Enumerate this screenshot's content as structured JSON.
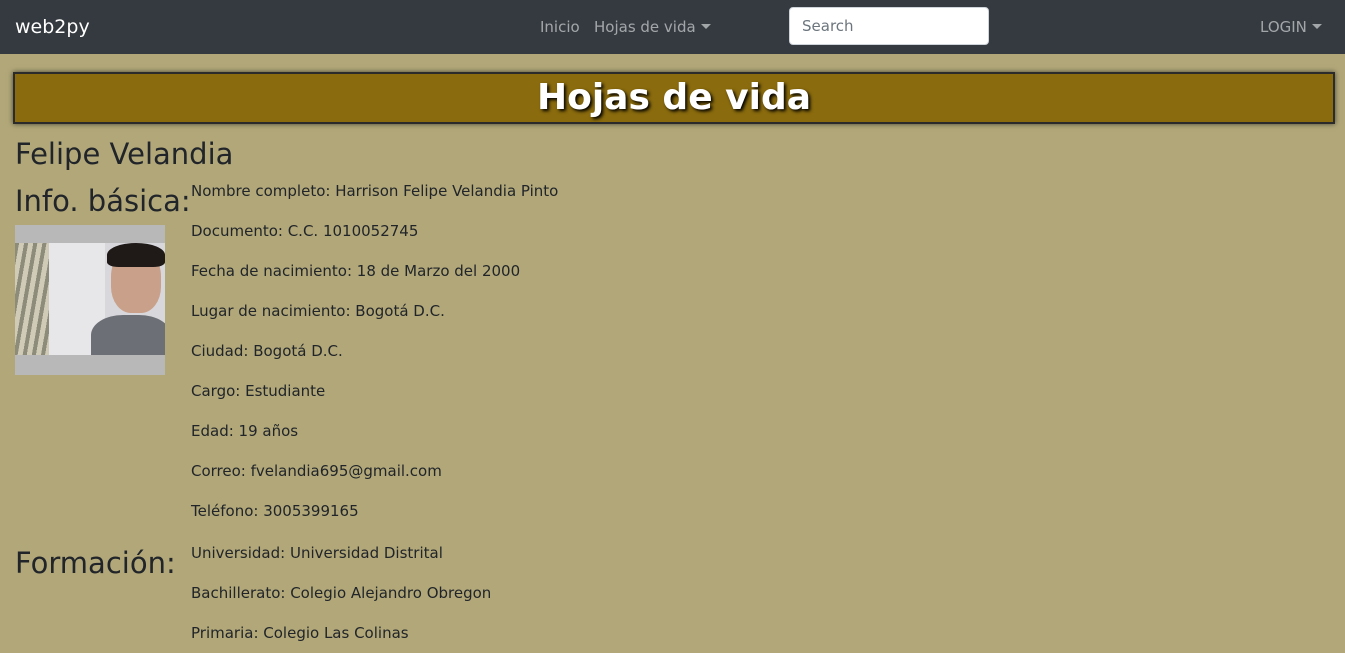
{
  "navbar": {
    "brand": "web2py",
    "inicio": "Inicio",
    "hojas_de_vida": "Hojas de vida",
    "search_placeholder": "Search",
    "login": "LOGIN"
  },
  "banner": {
    "title": "Hojas de vida"
  },
  "person": {
    "name": "Felipe Velandia"
  },
  "sections": {
    "basic_title": "Info. básica:",
    "formation_title": "Formación:"
  },
  "basic_info": [
    "Nombre completo: Harrison Felipe Velandia Pinto",
    "Documento: C.C. 1010052745",
    "Fecha de nacimiento: 18 de Marzo del 2000",
    "Lugar de nacimiento: Bogotá D.C.",
    "Ciudad: Bogotá D.C.",
    "Cargo: Estudiante",
    "Edad: 19 años",
    "Correo: fvelandia695@gmail.com",
    "Teléfono: 3005399165"
  ],
  "formation": [
    "Universidad: Universidad Distrital",
    "Bachillerato: Colegio Alejandro Obregon",
    "Primaria: Colegio Las Colinas"
  ],
  "colors": {
    "navbar_bg": "#343a40",
    "page_bg": "#b1a779",
    "banner_bg": "#8a6b0d"
  }
}
